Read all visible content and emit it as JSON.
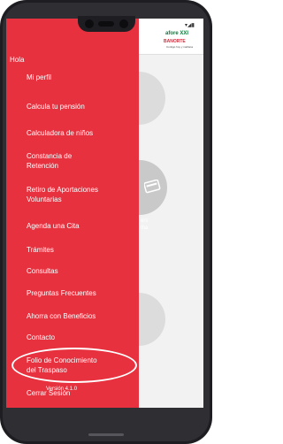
{
  "drawer": {
    "greeting": "Hola",
    "items": [
      {
        "label": "Mi perfil"
      },
      {
        "label": "Calcula tu pensión"
      },
      {
        "label": "Calculadora de niños"
      },
      {
        "label": "Constancia de Retención",
        "line1": "Constancia de",
        "line2": "Retención"
      },
      {
        "label": "Retiro de Aportaciones Voluntarias",
        "line1": "Retiro de Aportaciones",
        "line2": "Voluntarias"
      },
      {
        "label": "Agenda una Cita"
      },
      {
        "label": "Trámites"
      },
      {
        "label": "Consultas"
      },
      {
        "label": "Preguntas Frecuentes"
      },
      {
        "label": "Ahorra con Beneficios"
      },
      {
        "label": "Contacto"
      },
      {
        "label": "Folio de Conocimiento del Traspaso",
        "line1": "Folio de Conocimiento",
        "line2": "del Traspaso"
      },
      {
        "label": "Cerrar Sesión"
      }
    ],
    "version": "Versión 4.1.0"
  },
  "background": {
    "logo": "afore XXI",
    "logo_brand": "BANORTE",
    "logo_tagline": "Contigo hoy y mañana",
    "status_icons": "▾◢▮",
    "partial_label1": "ers",
    "partial_label2": "tha"
  },
  "colors": {
    "drawer": "#e8313f",
    "phone_frame": "#1e1e22",
    "highlight": "#ffffff"
  },
  "icons": [
    "camera-icon",
    "speaker-icon",
    "card-icon"
  ]
}
